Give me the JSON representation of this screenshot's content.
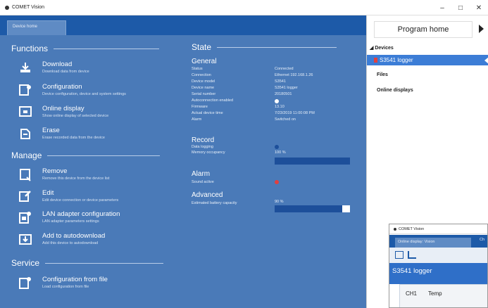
{
  "window": {
    "title": "COMET Vision",
    "min_glyph": "–",
    "max_glyph": "□",
    "close_glyph": "✕"
  },
  "tabs": [
    {
      "label": "Device home"
    }
  ],
  "functions": {
    "title": "Functions",
    "items": [
      {
        "label": "Download",
        "desc": "Download data from device",
        "icon": "download-icon"
      },
      {
        "label": "Configuration",
        "desc": "Device configuration, device and system settings",
        "icon": "configuration-icon"
      },
      {
        "label": "Online display",
        "desc": "Show online display of selected device",
        "icon": "online-display-icon"
      },
      {
        "label": "Erase",
        "desc": "Erase recorded data from the device",
        "icon": "erase-icon"
      }
    ]
  },
  "manage": {
    "title": "Manage",
    "items": [
      {
        "label": "Remove",
        "desc": "Remove this device from the device list",
        "icon": "remove-icon"
      },
      {
        "label": "Edit",
        "desc": "Edit device connection or device parameters",
        "icon": "edit-icon"
      },
      {
        "label": "LAN adapter configuration",
        "desc": "LAN adapter parameters settings",
        "icon": "lan-adapter-icon"
      },
      {
        "label": "Add to autodownload",
        "desc": "Add this device to autodownload",
        "icon": "autodownload-icon"
      }
    ]
  },
  "service": {
    "title": "Service",
    "items": [
      {
        "label": "Configuration from file",
        "desc": "Load configuration from file",
        "icon": "config-file-icon"
      }
    ]
  },
  "state": {
    "title": "State",
    "general": {
      "title": "General",
      "rows": [
        {
          "label": "Status",
          "value": "Connected"
        },
        {
          "label": "Connection",
          "value": "Ethernet 192.168.1.26"
        },
        {
          "label": "Device model",
          "value": "S3541"
        },
        {
          "label": "Device name",
          "value": "S3541 logger"
        },
        {
          "label": "Serial number",
          "value": "20180501"
        },
        {
          "label": "Autoconnection enabled",
          "value": ""
        },
        {
          "label": "Firmware",
          "value": "13.10"
        },
        {
          "label": "Actual device time",
          "value": "7/23/2019 11:00:08 PM"
        },
        {
          "label": "Alarm",
          "value": "Switched on"
        }
      ]
    },
    "record": {
      "title": "Record",
      "rows": [
        {
          "label": "Data logging",
          "value": ""
        },
        {
          "label": "Memory occupancy",
          "value": "100 %"
        }
      ],
      "memory_fraction": 1.0
    },
    "alarm": {
      "title": "Alarm",
      "rows": [
        {
          "label": "Sound active",
          "value": ""
        }
      ]
    },
    "advanced": {
      "title": "Advanced",
      "rows": [
        {
          "label": "Estimated battery capacity",
          "value": "90 %"
        }
      ],
      "battery_fraction": 0.9
    }
  },
  "right_panel": {
    "home_button": "Program home",
    "devices_label": "Devices",
    "selected_device": "S3541 logger",
    "files_label": "Files",
    "online_displays_label": "Online displays"
  },
  "mini_window": {
    "title": "COMET Vision",
    "tab_label": "Online display: Vision",
    "tab_label_2": "Ch",
    "device": "S3541 logger",
    "col1": "CH1",
    "col2": "Temp"
  },
  "colors": {
    "app_bg": "#4a7ab8",
    "tabbar": "#1d5aa8",
    "selection": "#3c7dd6",
    "alarm_dot": "#e04040",
    "record_dot": "#1d4f9a"
  }
}
